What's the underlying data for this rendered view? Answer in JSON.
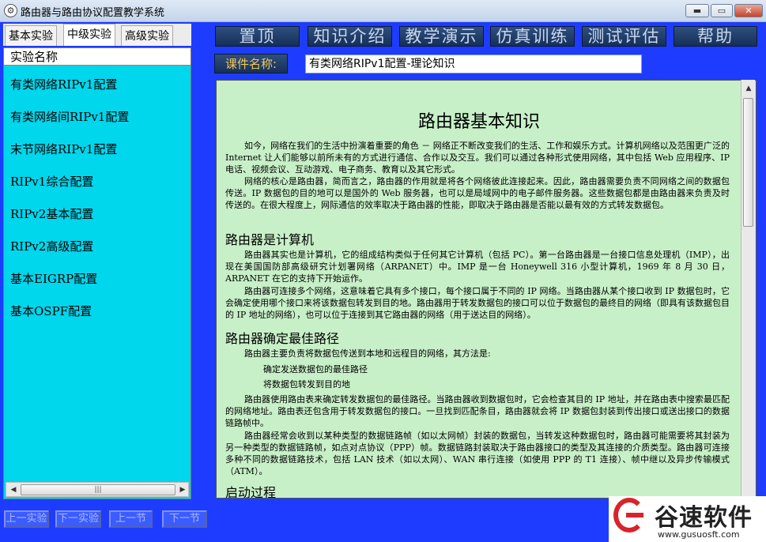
{
  "window": {
    "title": "路由器与路由协议配置教学系统",
    "app_icon": "gear-globe-icon",
    "buttons": {
      "minimize": "▬",
      "maximize": "▭",
      "close": "✕"
    }
  },
  "left_tabs": [
    "基本实验",
    "中级实验",
    "高级实验"
  ],
  "left_tabs_active": "中级实验",
  "list": {
    "header": "实验名称",
    "items": [
      "有类网络RIPv1配置",
      "有类网络间RIPv1配置",
      "末节网络RIPv1配置",
      "RIPv1综合配置",
      "RIPv2基本配置",
      "RIPv2高级配置",
      "基本EIGRP配置",
      "基本OSPF配置"
    ]
  },
  "scroll": {
    "left_arrow": "◀",
    "right_arrow": "▶",
    "up_arrow": "▲",
    "down_arrow": "▼",
    "grip": "|||"
  },
  "bottom_nav": [
    "上一实验",
    "下一实验",
    "上一节",
    "下一节"
  ],
  "top_menu": [
    "置顶",
    "知识介绍",
    "教学演示",
    "仿真训练",
    "测试评估",
    "帮助"
  ],
  "course": {
    "label": "课件名称:",
    "value": "有类网络RIPv1配置-理论知识"
  },
  "doc": {
    "title": "路由器基本知识",
    "p1": "如今，网络在我们的生活中扮演着重要的角色 － 网络正不断改变我们的生活、工作和娱乐方式。计算机网络以及范围更广泛的 Internet 让人们能够以前所未有的方式进行通信、合作以及交互。我们可以通过各种形式使用网络，其中包括 Web 应用程序、IP 电话、视频会议、互动游戏、电子商务、教育以及其它形式。",
    "p2": "网络的核心是路由器，简而言之，路由器的作用就是将各个网络彼此连接起来。因此，路由器需要负责不同网络之间的数据包传送。IP 数据包的目的地可以是国外的 Web 服务器，也可以是局域网中的电子邮件服务器。这些数据包都是由路由器来负责及时传送的。在很大程度上，网际通信的效率取决于路由器的性能，即取决于路由器是否能以最有效的方式转发数据包。",
    "h_computer": "路由器是计算机",
    "p3": "路由器其实也是计算机，它的组成结构类似于任何其它计算机（包括 PC）。第一台路由器是一台接口信息处理机（IMP），出现在美国国防部高级研究计划署网络（ARPANET）中。IMP 是一台 Honeywell 316 小型计算机，1969 年 8 月 30 日，ARPANET 在它的支持下开始运作。",
    "p4": "路由器可连接多个网络，这意味着它具有多个接口，每个接口属于不同的 IP 网络。当路由器从某个接口收到 IP 数据包时，它会确定使用哪个接口来将该数据包转发到目的地。路由器用于转发数据包的接口可以位于数据包的最终目的网络（即具有该数据包目的 IP 地址的网络），也可以位于连接到其它路由器的网络（用于送达目的网络）。",
    "h_best_path": "路由器确定最佳路径",
    "p5": "路由器主要负责将数据包传送到本地和远程目的网络，其方法是:",
    "b1": "确定发送数据包的最佳路径",
    "b2": "将数据包转发到目的地",
    "p6": "路由器使用路由表来确定转发数据包的最佳路径。当路由器收到数据包时，它会检查其目的 IP 地址，并在路由表中搜索最匹配的网络地址。路由表还包含用于转发数据包的接口。一旦找到匹配条目，路由器就会将 IP 数据包封装到传出接口或送出接口的数据链路帧中。",
    "p7": "路由器经常会收到以某种类型的数据链路帧（如以太网帧）封装的数据包，当转发这种数据包时，路由器可能需要将其封装为另一种类型的数据链路帧，如点对点协议（PPP）帧。数据链路封装取决于路由器接口的类型及其连接的介质类型。路由器可连接多种不同的数据链路技术，包括 LAN 技术（如以太网）、WAN 串行连接（如使用 PPP 的 T1 连接）、帧中继以及异步传输模式（ATM）。",
    "h_boot": "启动过程"
  },
  "watermark": {
    "name": "谷速软件",
    "url": "www.gusuosft.com",
    "logo_icon": "gusuo-g-logo-icon"
  }
}
